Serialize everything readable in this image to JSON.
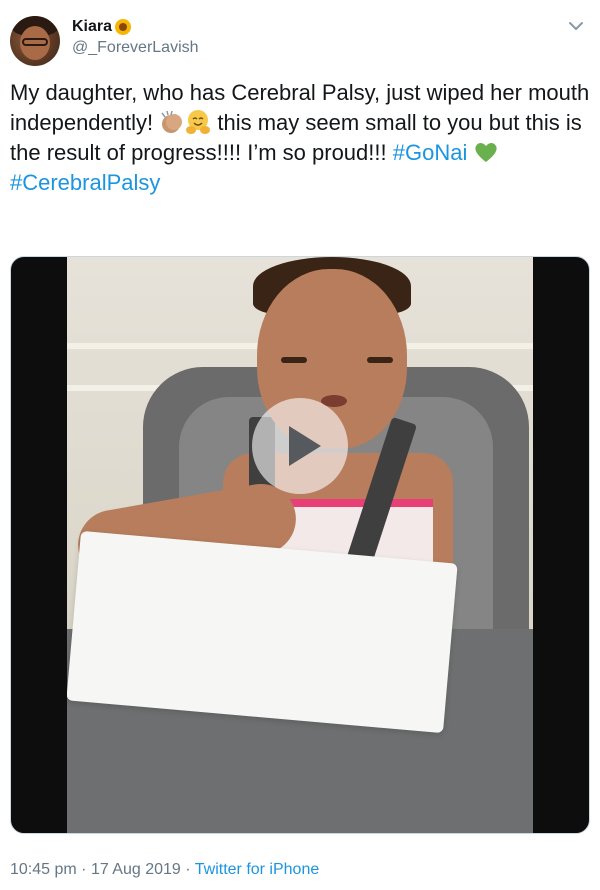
{
  "user": {
    "display_name": "Kiara",
    "handle": "@_ForeverLavish",
    "badge_emoji": "sunflower-emoji"
  },
  "tweet": {
    "text_1": "My daughter, who has Cerebral Palsy, just wiped her mouth independently! ",
    "emoji_1": "clapping-hands-emoji",
    "emoji_2": "hugging-face-emoji",
    "text_2": " this may seem small to you but this is the result of progress!!!! I’m so proud!!! ",
    "hashtag_1": "#GoNai",
    "emoji_3": "green-heart-emoji",
    "hashtag_2": "#CerebralPalsy"
  },
  "media": {
    "type": "video",
    "play_icon": "play-icon"
  },
  "meta": {
    "time": "10:45 pm",
    "separator_1": " · ",
    "date": "17 Aug 2019",
    "separator_2": " · ",
    "source": "Twitter for iPhone"
  },
  "colors": {
    "link": "#1b95e0",
    "secondary_text": "#657786",
    "primary_text": "#14171a",
    "heart": "#6ab04c"
  }
}
